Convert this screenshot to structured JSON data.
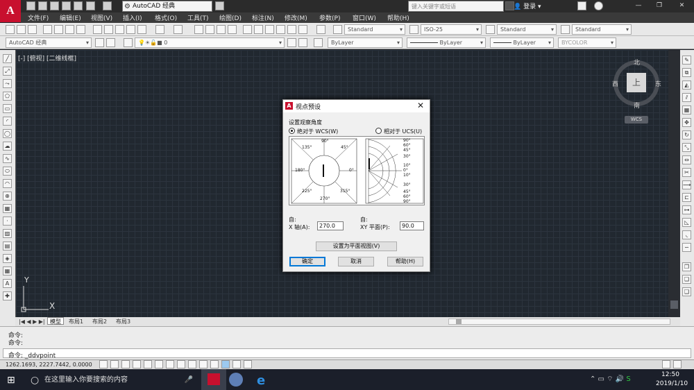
{
  "app": {
    "logo_letter": "A",
    "workspace": "AutoCAD 经典",
    "search_placeholder": "键入关键字或短语",
    "login": "登录",
    "min": "—",
    "max": "❐",
    "close": "✕"
  },
  "menu": [
    "文件(F)",
    "编辑(E)",
    "视图(V)",
    "插入(I)",
    "格式(O)",
    "工具(T)",
    "绘图(D)",
    "标注(N)",
    "修改(M)",
    "参数(P)",
    "窗口(W)",
    "帮助(H)"
  ],
  "toolbar1": {
    "text_style": "Standard",
    "dim_style": "ISO-25",
    "table_style": "Standard",
    "mleader_style": "Standard"
  },
  "toolbar2": {
    "workspace": "AutoCAD 经典",
    "layer": "0",
    "color": "ByLayer",
    "linetype": "ByLayer",
    "lineweight": "ByLayer",
    "plotstyle": "BYCOLOR"
  },
  "viewport": {
    "label": "[-] [俯视] [二维线框]",
    "cube_top": "上",
    "north": "北",
    "south": "南",
    "east": "东",
    "west": "西",
    "wcs": "WCS",
    "ucs_x": "X",
    "ucs_y": "Y"
  },
  "tabs": [
    "模型",
    "布局1",
    "布局2",
    "布局3"
  ],
  "command": {
    "line1": "命令:",
    "line2": "命令:",
    "line3": "命令: _ddvpoint"
  },
  "status": {
    "coords": "1262.1693, 2227.7442, 0.0000"
  },
  "dialog": {
    "title": "视点预设",
    "group_label": "设置观察角度",
    "radio_absolute": "绝对于 WCS(W)",
    "radio_relative": "相对于 UCS(U)",
    "from_label_1": "自:",
    "from_label_2": "自:",
    "x_axis_label": "X 轴(A):",
    "x_axis_value": "270.0",
    "xy_plane_label": "XY 平面(P):",
    "xy_plane_value": "90.0",
    "plan_view_button": "设置为平面视图(V)",
    "ok_button": "确定",
    "cancel_button": "取消",
    "help_button": "帮助(H)",
    "angles_left": [
      "90°",
      "45°",
      "0°",
      "315°",
      "270°",
      "225°",
      "180°",
      "135°"
    ],
    "angles_right": [
      "90°",
      "60°",
      "45°",
      "30°",
      "10°",
      "0°",
      "10°",
      "30°",
      "45°",
      "60°",
      "90°"
    ]
  },
  "taskbar": {
    "search_text": "在这里输入你要搜索的内容",
    "time": "12:50",
    "date": "2019/1/10"
  }
}
